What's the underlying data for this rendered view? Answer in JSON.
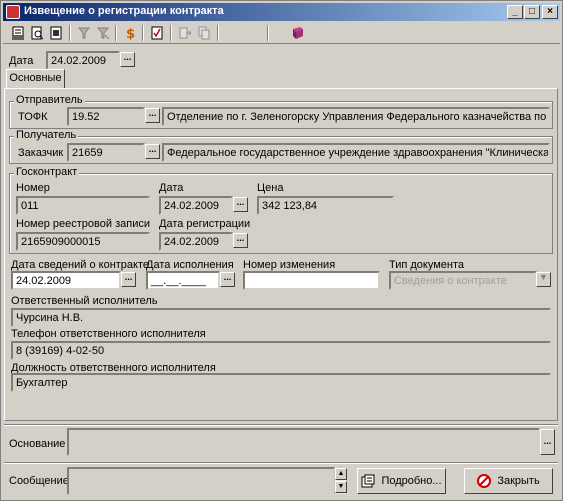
{
  "window": {
    "title": "Извещение о регистрации контракта",
    "minimize": "_",
    "maximize": "□",
    "close": "×"
  },
  "date": {
    "label": "Дата",
    "value": "24.02.2009"
  },
  "tab": {
    "label": "Основные"
  },
  "sender": {
    "group_title": "Отправитель",
    "tofk_label": "ТОФК",
    "tofk_code": "19.52",
    "tofk_name": "Отделение по г. Зеленогорску Управления Федерального казначейства по Красноярс"
  },
  "recipient": {
    "group_title": "Получатель",
    "customer_label": "Заказчик",
    "customer_code": "21659",
    "customer_name": "Федеральное государственное учреждение здравоохранения \"Клиническая больница"
  },
  "contract": {
    "group_title": "Госконтракт",
    "number_label": "Номер",
    "number_value": "011",
    "date_label": "Дата",
    "date_value": "24.02.2009",
    "price_label": "Цена",
    "price_value": "342 123,84",
    "registry_label": "Номер реестровой записи",
    "registry_value": "2165909000015",
    "reg_date_label": "Дата регистрации",
    "reg_date_value": "24.02.2009"
  },
  "details": {
    "info_date_label": "Дата сведений о контракте",
    "info_date_value": "24.02.2009",
    "exec_date_label": "Дата исполнения",
    "exec_date_value": "__.__.____",
    "change_number_label": "Номер изменения",
    "change_number_value": "",
    "doc_type_label": "Тип документа",
    "doc_type_value": "Сведения о контракте"
  },
  "responsible": {
    "person_label": "Ответственный исполнитель",
    "person_value": "Чурсина Н.В.",
    "phone_label": "Телефон ответственного исполнителя",
    "phone_value": "8 (39169) 4-02-50",
    "position_label": "Должность ответственного исполнителя",
    "position_value": "Бухгалтер"
  },
  "footer": {
    "basis_label": "Основание",
    "basis_value": "",
    "message_label": "Сообщение",
    "message_value": "",
    "details_button": "Подробно...",
    "close_button": "Закрыть"
  },
  "icons": {
    "ellipsis": "...",
    "dropdown": "▼",
    "scroll_up": "▲",
    "scroll_down": "▼"
  }
}
